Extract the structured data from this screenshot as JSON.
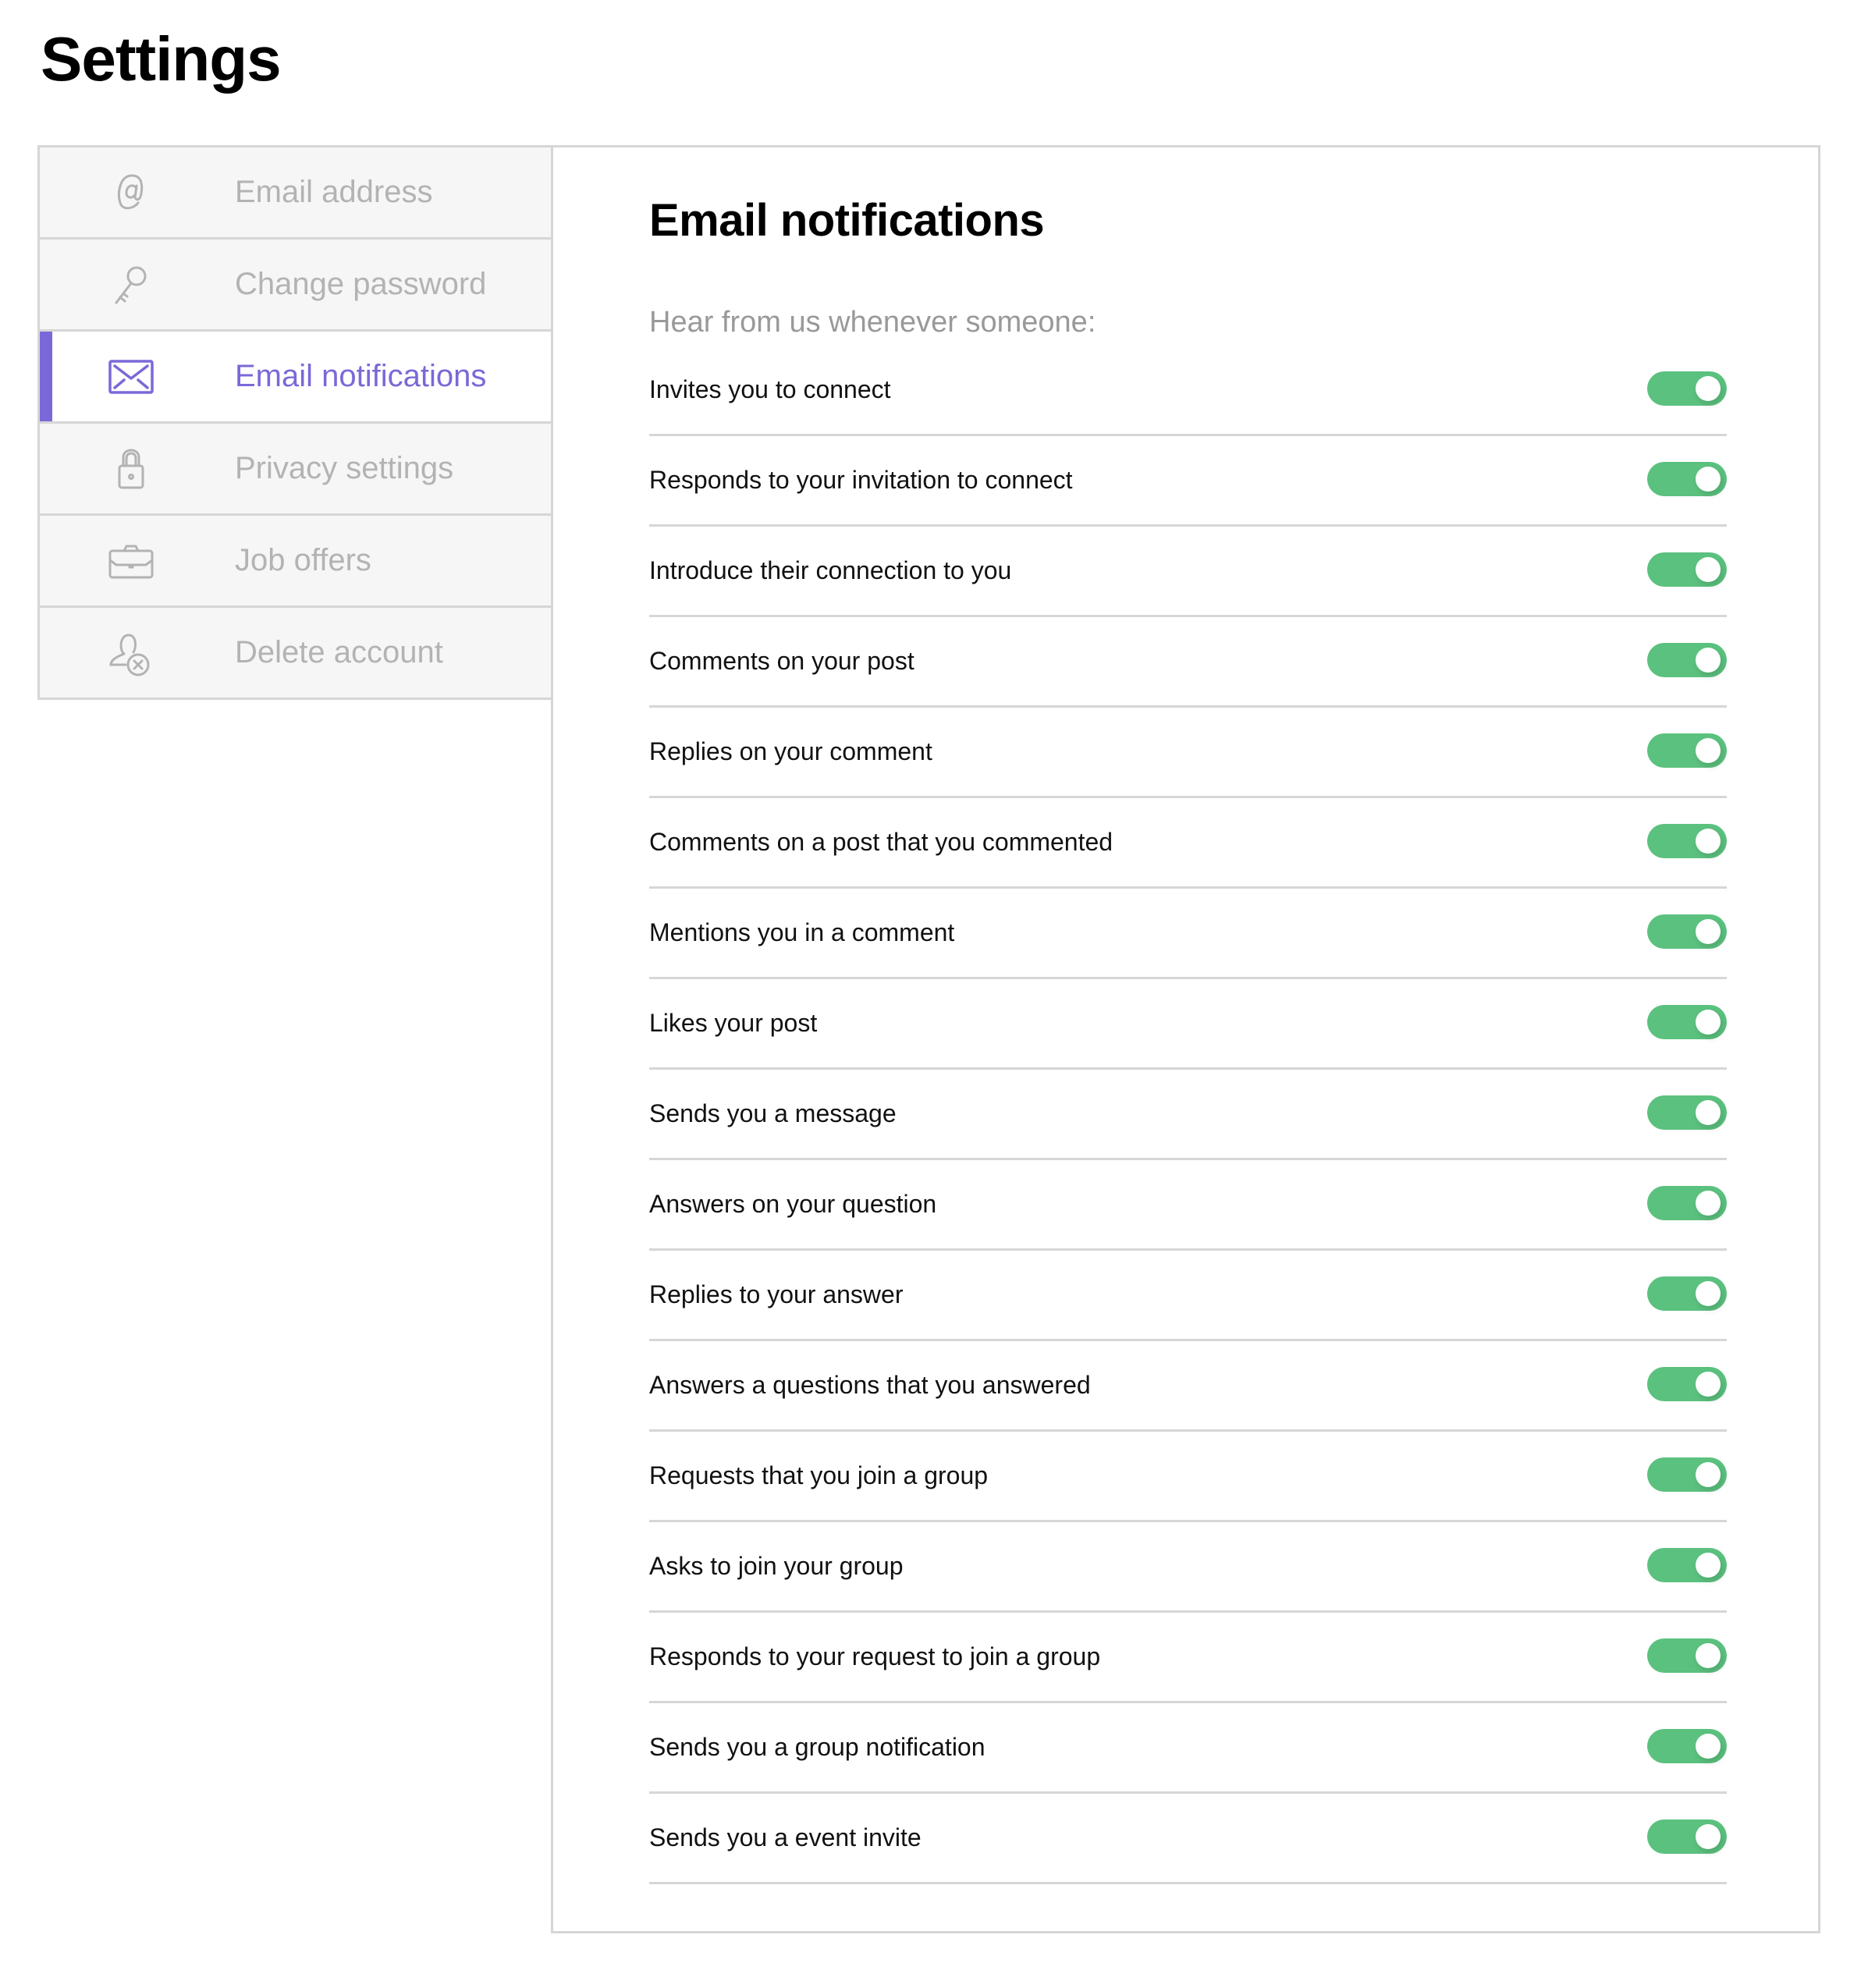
{
  "page": {
    "title": "Settings"
  },
  "colors": {
    "accent": "#7b68d8",
    "toggle_on": "#5bc17e",
    "muted": "#b3b3b3",
    "border": "#d6d6d6",
    "sidebar_bg": "#f6f6f6"
  },
  "sidebar": {
    "items": [
      {
        "label": "Email address",
        "icon": "at-sign-icon",
        "active": false
      },
      {
        "label": "Change password",
        "icon": "key-icon",
        "active": false
      },
      {
        "label": "Email notifications",
        "icon": "envelope-icon",
        "active": true
      },
      {
        "label": "Privacy settings",
        "icon": "lock-icon",
        "active": false
      },
      {
        "label": "Job offers",
        "icon": "briefcase-icon",
        "active": false
      },
      {
        "label": "Delete account",
        "icon": "user-remove-icon",
        "active": false
      }
    ]
  },
  "panel": {
    "heading": "Email notifications",
    "subtitle": "Hear from us whenever someone:",
    "notifications": [
      {
        "label": "Invites you to connect",
        "enabled": true
      },
      {
        "label": "Responds to your invitation to connect",
        "enabled": true
      },
      {
        "label": "Introduce their connection to you",
        "enabled": true
      },
      {
        "label": "Comments on your post",
        "enabled": true
      },
      {
        "label": "Replies on your comment",
        "enabled": true
      },
      {
        "label": "Comments on a post that you commented",
        "enabled": true
      },
      {
        "label": "Mentions you in a comment",
        "enabled": true
      },
      {
        "label": "Likes your post",
        "enabled": true
      },
      {
        "label": "Sends you a message",
        "enabled": true
      },
      {
        "label": "Answers on your question",
        "enabled": true
      },
      {
        "label": "Replies to your answer",
        "enabled": true
      },
      {
        "label": "Answers a questions that you answered",
        "enabled": true
      },
      {
        "label": "Requests that you join a group",
        "enabled": true
      },
      {
        "label": "Asks to join your group",
        "enabled": true
      },
      {
        "label": "Responds to your request to join a group",
        "enabled": true
      },
      {
        "label": "Sends you a group notification",
        "enabled": true
      },
      {
        "label": "Sends you a event invite",
        "enabled": true
      }
    ]
  }
}
